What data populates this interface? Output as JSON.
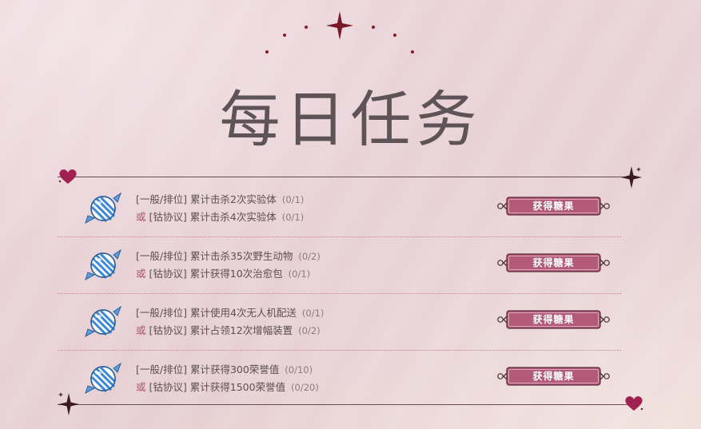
{
  "page": {
    "title": "每日任务"
  },
  "colors": {
    "accent": "#b4587a",
    "button_fill": "#b35a78",
    "heart": "#a0204f",
    "star": "#7a1828"
  },
  "tasks": [
    {
      "line1": {
        "prefix": "[一般/排位]",
        "text": "累计击杀2次实验体",
        "progress": "(0/1)"
      },
      "line2": {
        "or": "或",
        "prefix": "[钴协议]",
        "text": "累计击杀4次实验体",
        "progress": "(0/1)"
      },
      "button": "获得糖果",
      "icon": "candy-icon"
    },
    {
      "line1": {
        "prefix": "[一般/排位]",
        "text": "累计击杀35次野生动物",
        "progress": "(0/2)"
      },
      "line2": {
        "or": "或",
        "prefix": "[钴协议]",
        "text": "累计获得10次治愈包",
        "progress": "(0/1)"
      },
      "button": "获得糖果",
      "icon": "candy-icon"
    },
    {
      "line1": {
        "prefix": "[一般/排位]",
        "text": "累计使用4次无人机配送",
        "progress": "(0/1)"
      },
      "line2": {
        "or": "或",
        "prefix": "[钴协议]",
        "text": "累计占领12次增幅装置",
        "progress": "(0/2)"
      },
      "button": "获得糖果",
      "icon": "candy-icon"
    },
    {
      "line1": {
        "prefix": "[一般/排位]",
        "text": "累计获得300荣誉值",
        "progress": "(0/10)"
      },
      "line2": {
        "or": "或",
        "prefix": "[钴协议]",
        "text": "累计获得1500荣誉值",
        "progress": "(0/20)"
      },
      "button": "获得糖果",
      "icon": "candy-icon"
    }
  ]
}
